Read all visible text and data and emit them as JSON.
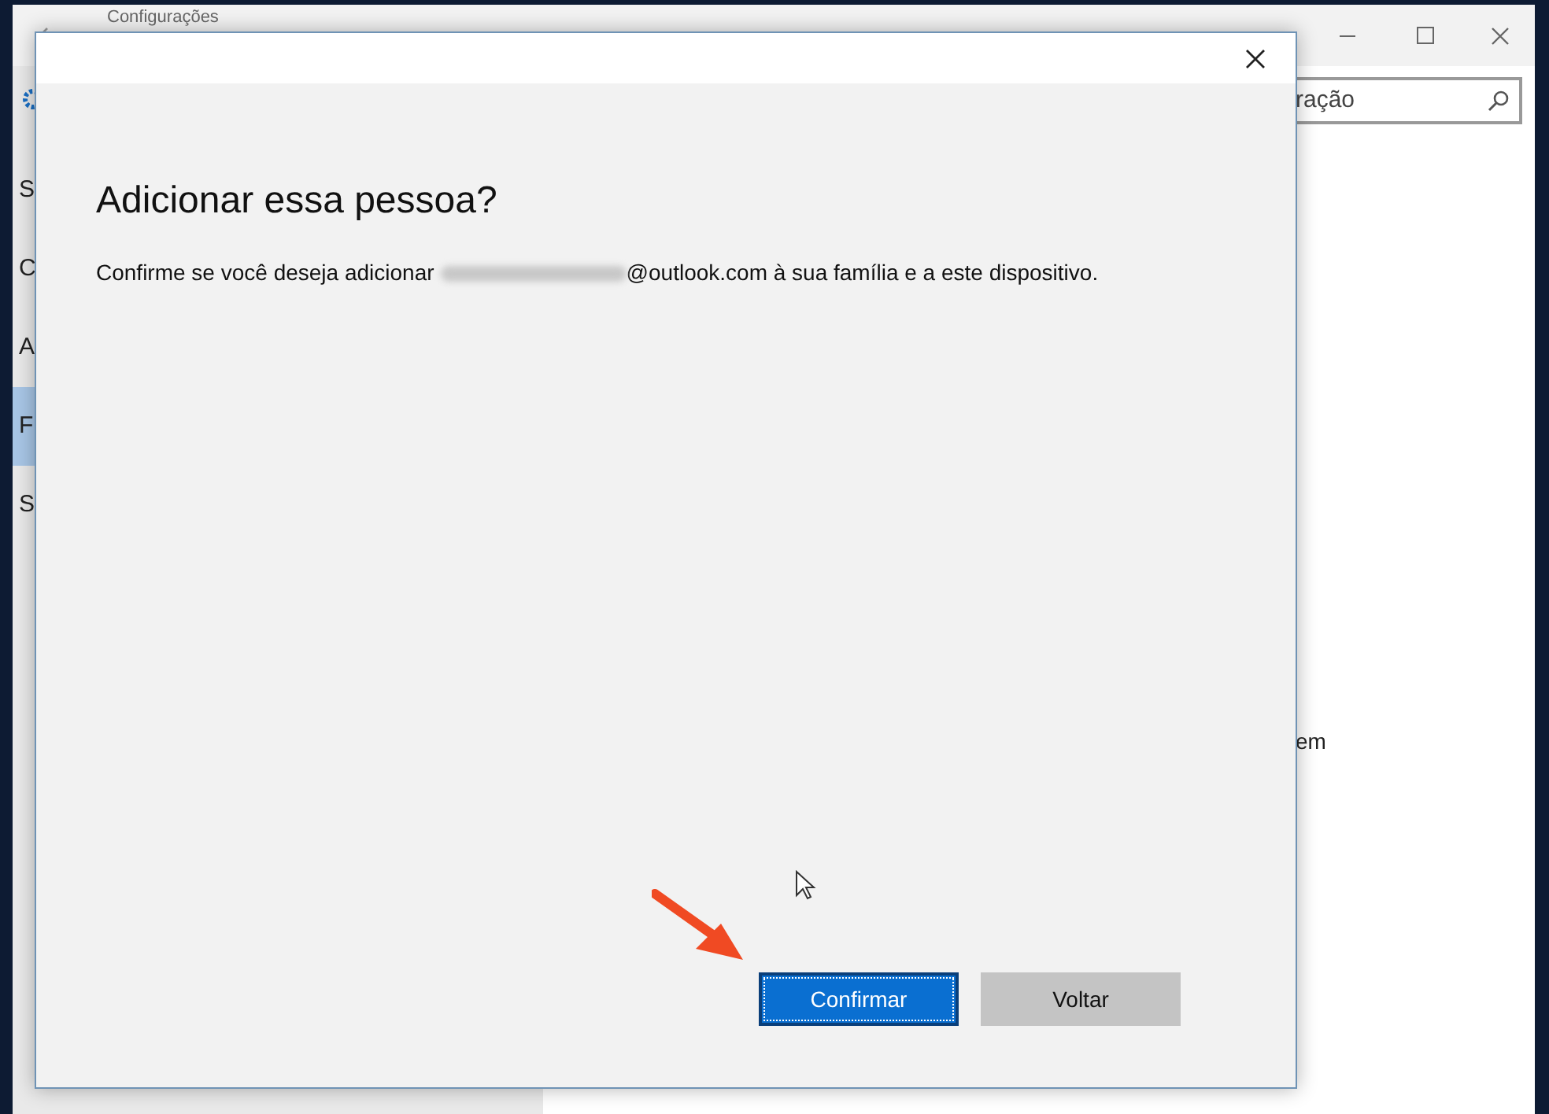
{
  "settings_window": {
    "title": "Configurações",
    "search": {
      "value": "ração"
    },
    "sidebar": {
      "items": [
        {
          "label": "S",
          "selected": false
        },
        {
          "label": "C",
          "selected": false
        },
        {
          "label": "A",
          "selected": false
        },
        {
          "label": "F",
          "selected": true
        },
        {
          "label": "S",
          "selected": false
        }
      ]
    },
    "content_fragment": "em"
  },
  "dialog": {
    "title": "Adicionar essa pessoa?",
    "message_before": "Confirme se você deseja adicionar",
    "message_after": "@outlook.com à sua família e a este dispositivo.",
    "buttons": [
      {
        "label": "Confirmar",
        "kind": "primary"
      },
      {
        "label": "Voltar",
        "kind": "secondary"
      }
    ]
  }
}
